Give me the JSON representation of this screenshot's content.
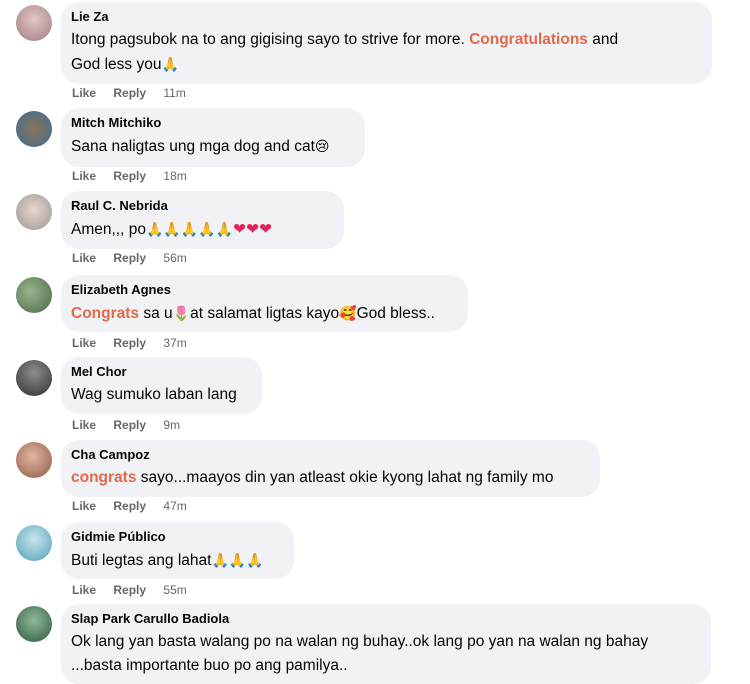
{
  "comments": [
    {
      "author": "Lie Za",
      "pre": "Itong pagsubok na to ang gigising sayo to strive for more. ",
      "hl": "Congratulations",
      "post": " and",
      "line2": "God less you",
      "emoji": "🙏",
      "time": "11m",
      "avatar_color": "#c2a3a8"
    },
    {
      "author": "Mitch Mitchiko",
      "pre": "Sana naligtas ung mga dog and cat",
      "emoji": "😢",
      "time": "18m",
      "avatar_color": "#4a8fb8"
    },
    {
      "author": "Raul C. Nebrida",
      "pre": "Amen,,, po",
      "emoji": "🙏🙏🙏🙏🙏",
      "hearts": "❤❤❤",
      "time": "56m",
      "avatar_color": "#b9b3ae"
    },
    {
      "author": "Elizabeth Agnes",
      "hl": "Congrats",
      "pre": " sa u",
      "emoji1": "🌷",
      "mid": "at salamat ligtas kayo",
      "emoji2": "🥰",
      "post": "God bless..",
      "time": "37m",
      "avatar_color": "#6f8f6a"
    },
    {
      "author": "Mel Chor",
      "pre": "Wag sumuko laban lang",
      "time": "9m",
      "avatar_color": "#5b5e60"
    },
    {
      "author": "Cha Campoz",
      "hl": "congrats",
      "pre": " sayo...maayos din yan atleast okie kyong lahat ng family mo",
      "time": "47m",
      "avatar_color": "#b8826a"
    },
    {
      "author": "Gidmie Público",
      "pre": "Buti legtas ang lahat",
      "emoji": "🙏🙏🙏",
      "time": "55m",
      "avatar_color": "#7fb6c9"
    },
    {
      "author": "Slap Park Carullo Badiola",
      "pre": "Ok lang yan basta walang po na walan ng buhay..ok lang po yan na walan ng bahay",
      "line2": "...basta importante buo po ang pamilya..",
      "avatar_color": "#4e7a5c"
    }
  ],
  "actions": {
    "like": "Like",
    "reply": "Reply"
  }
}
